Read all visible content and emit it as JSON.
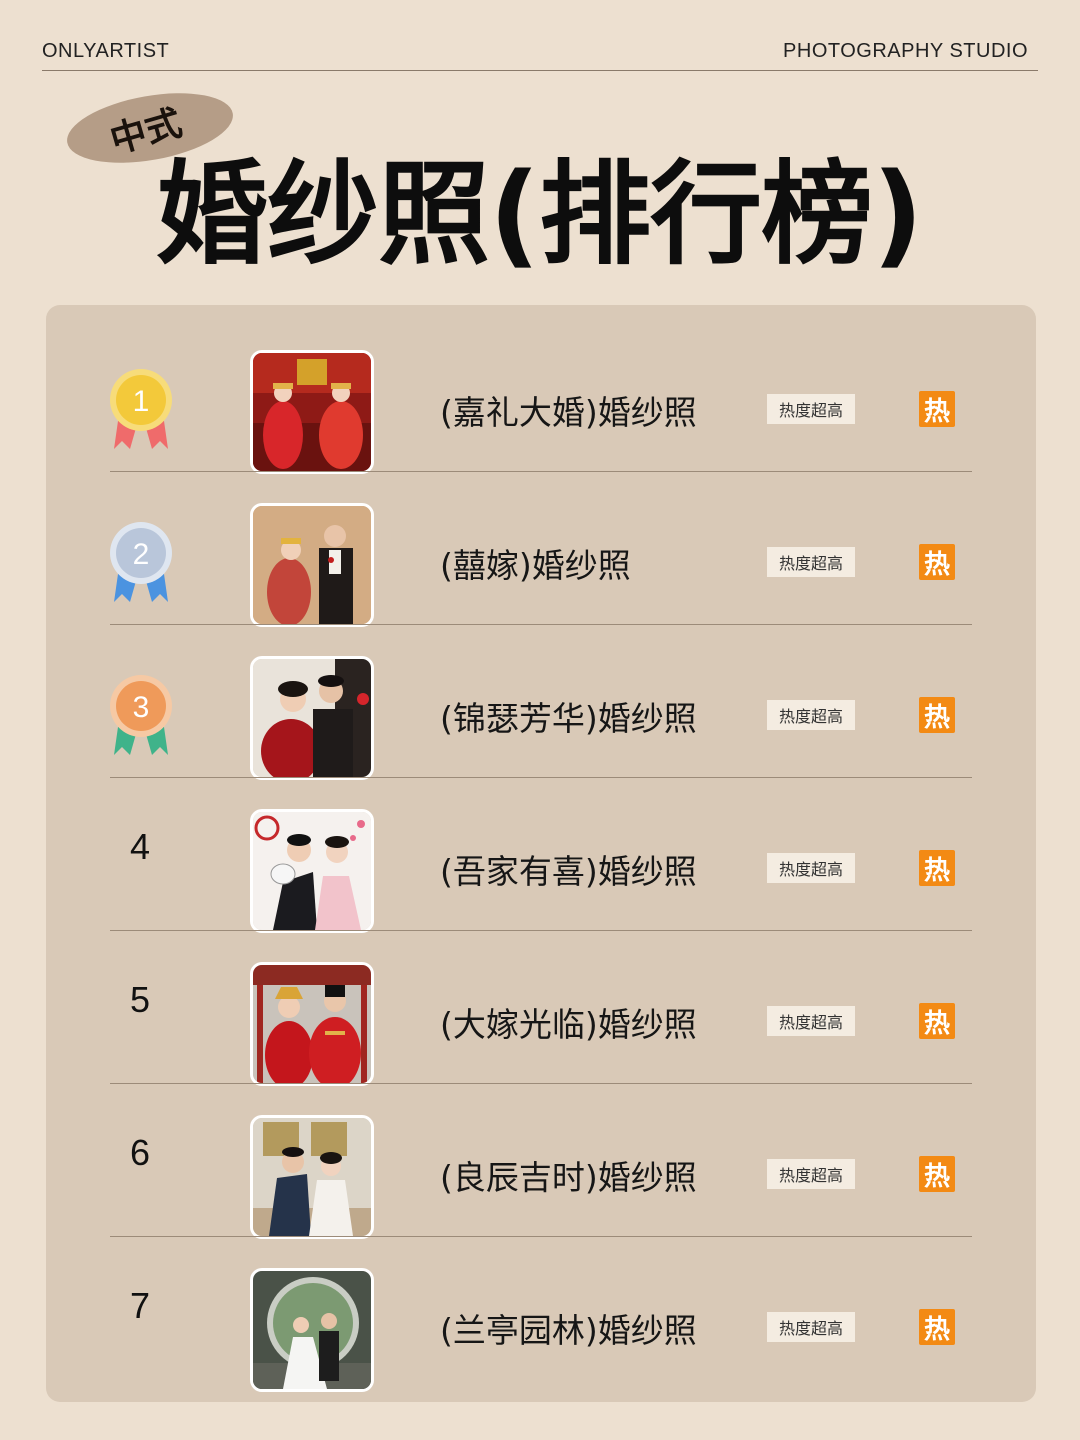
{
  "header": {
    "left": "ONLYARTIST",
    "right": "PHOTOGRAPHY STUDIO"
  },
  "tag": "中式",
  "title": "婚纱照(排行榜)",
  "hot_badge_label": "热度超高",
  "hot_icon_label": "热",
  "colors": {
    "background": "#ede0d0",
    "panel": "#d9c9b7",
    "tag_pill": "#b59d87",
    "hot_icon": "#f38a14",
    "gold": "#f3c93a",
    "silver": "#b9c6da",
    "bronze": "#ef9a5a"
  },
  "ranking": [
    {
      "rank": "1",
      "medal": "gold-medal-icon",
      "title": "(嘉礼大婚)婚纱照"
    },
    {
      "rank": "2",
      "medal": "silver-medal-icon",
      "title": "(囍嫁)婚纱照"
    },
    {
      "rank": "3",
      "medal": "bronze-medal-icon",
      "title": "(锦瑟芳华)婚纱照"
    },
    {
      "rank": "4",
      "medal": "",
      "title": "(吾家有喜)婚纱照"
    },
    {
      "rank": "5",
      "medal": "",
      "title": "(大嫁光临)婚纱照"
    },
    {
      "rank": "6",
      "medal": "",
      "title": "(良辰吉时)婚纱照"
    },
    {
      "rank": "7",
      "medal": "",
      "title": "(兰亭园林)婚纱照"
    }
  ]
}
